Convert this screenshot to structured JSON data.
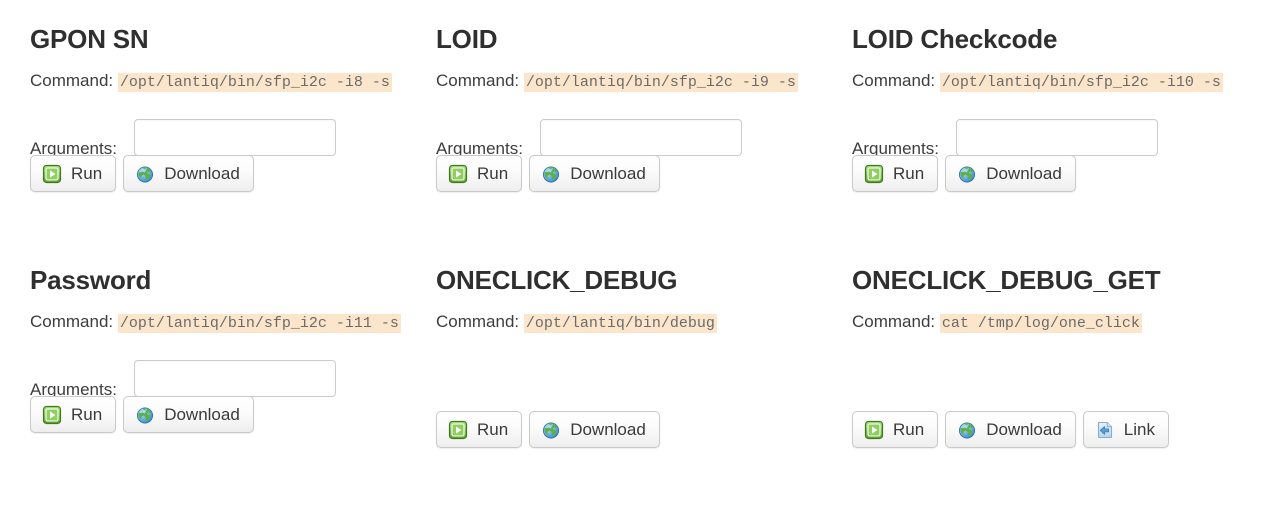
{
  "page": {
    "background": "#ffffff",
    "code_highlight_color": "#fce6cb",
    "accent_green": "#7cc24b",
    "accent_blue": "#7fb2e0"
  },
  "labels": {
    "command_label": "Command:",
    "arguments_label": "Arguments:",
    "run_label": "Run",
    "download_label": "Download",
    "link_label": "Link"
  },
  "icons": {
    "run": "play-icon",
    "download": "globe-icon",
    "link": "page-back-arrow-icon"
  },
  "cards": [
    {
      "id": "gpon-sn",
      "title": "GPON SN",
      "command": "/opt/lantiq/bin/sfp_i2c -i8 -s",
      "has_arguments": true,
      "arguments_value": "",
      "arguments_placeholder": "",
      "buttons": [
        "Run",
        "Download"
      ]
    },
    {
      "id": "loid",
      "title": "LOID",
      "command": "/opt/lantiq/bin/sfp_i2c -i9 -s",
      "has_arguments": true,
      "arguments_value": "",
      "arguments_placeholder": "",
      "buttons": [
        "Run",
        "Download"
      ]
    },
    {
      "id": "loid-checkcode",
      "title": "LOID Checkcode",
      "command": "/opt/lantiq/bin/sfp_i2c -i10 -s",
      "has_arguments": true,
      "arguments_value": "",
      "arguments_placeholder": "",
      "buttons": [
        "Run",
        "Download"
      ]
    },
    {
      "id": "password",
      "title": "Password",
      "command": "/opt/lantiq/bin/sfp_i2c -i11 -s",
      "has_arguments": true,
      "arguments_value": "",
      "arguments_placeholder": "",
      "buttons": [
        "Run",
        "Download"
      ]
    },
    {
      "id": "oneclick-debug",
      "title": "ONECLICK_DEBUG",
      "command": "/opt/lantiq/bin/debug",
      "has_arguments": false,
      "arguments_value": "",
      "arguments_placeholder": "",
      "buttons": [
        "Run",
        "Download"
      ]
    },
    {
      "id": "oneclick-debug-get",
      "title": "ONECLICK_DEBUG_GET",
      "command": "cat /tmp/log/one_click",
      "has_arguments": false,
      "arguments_value": "",
      "arguments_placeholder": "",
      "buttons": [
        "Run",
        "Download",
        "Link"
      ]
    }
  ]
}
